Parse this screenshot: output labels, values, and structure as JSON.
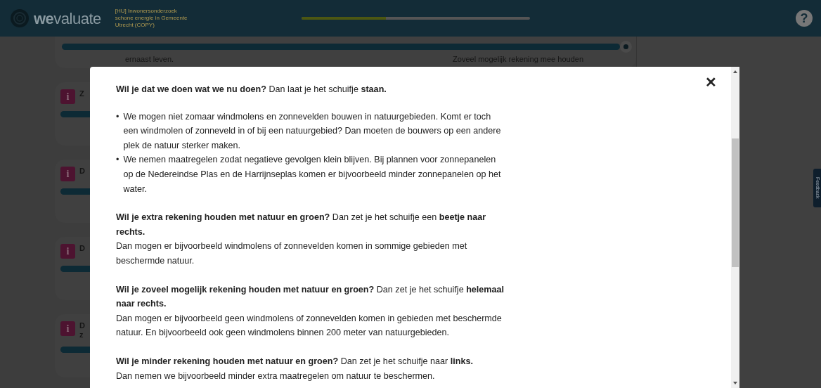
{
  "header": {
    "logo": "**we**valuate",
    "survey_title": "[HU] Inwonersonderzoek schone energie in Gemeente Utrecht (COPY)",
    "progress": {
      "level": 0.37
    },
    "help": "?"
  },
  "background": {
    "top_card": {
      "slider": {
        "level": 1.0
      },
      "left_text": "ernaast leven.",
      "right_label": "Zoveel mogelijk rekening mee houden"
    },
    "cards": [
      {
        "info": "i",
        "title": [
          "Z"
        ]
      },
      {
        "info": "i",
        "title": [
          "D"
        ]
      },
      {
        "info": "i",
        "title": [
          "D"
        ]
      },
      {
        "info": "i",
        "title": [
          "D",
          "z"
        ]
      }
    ],
    "feedback_tab": "Feedback"
  },
  "modal": {
    "close": "✕",
    "bullet_marker": "•",
    "sections": [
      {
        "question": "**Wil je dat we doen wat we nu doen?** Dan laat je het schuifje **staan.**",
        "bullets": [
          "We mogen niet zomaar windmolens en zonnevelden bouwen in natuurgebieden. Komt er toch een windmolen of zonneveld in of bij een natuurgebied? Dan moeten de bouwers op een andere plek de natuur sterker maken.",
          "We nemen maatregelen zodat negatieve gevolgen klein blijven. Bij plannen voor zonnepanelen op de Nedereindse Plas en de Harrijnseplas komen er bijvoorbeeld minder zonnepanelen op het water."
        ]
      },
      {
        "question": "**Wil je extra rekening houden met natuur en groen?**  Dan zet je het schuifje een **beetje naar rechts.**",
        "explanation": "Dan mogen er bijvoorbeeld windmolens of zonnevelden komen in sommige gebieden met beschermde natuur."
      },
      {
        "question": "**Wil je zoveel mogelijk rekening houden met natuur en groen?** Dan zet je het schuifje **helemaal naar rechts.**",
        "explanation": "Dan mogen er bijvoorbeeld geen windmolens of zonnevelden komen in gebieden met beschermde natuur. En bijvoorbeeld ook geen windmolens binnen 200 meter van natuurgebieden."
      },
      {
        "question": "**Wil je minder rekening houden met natuur en groen?** Dan zet je het schuifje naar **links.**",
        "explanation": "Dan nemen we bijvoorbeeld minder extra maatregelen om natuur te beschermen."
      }
    ]
  }
}
